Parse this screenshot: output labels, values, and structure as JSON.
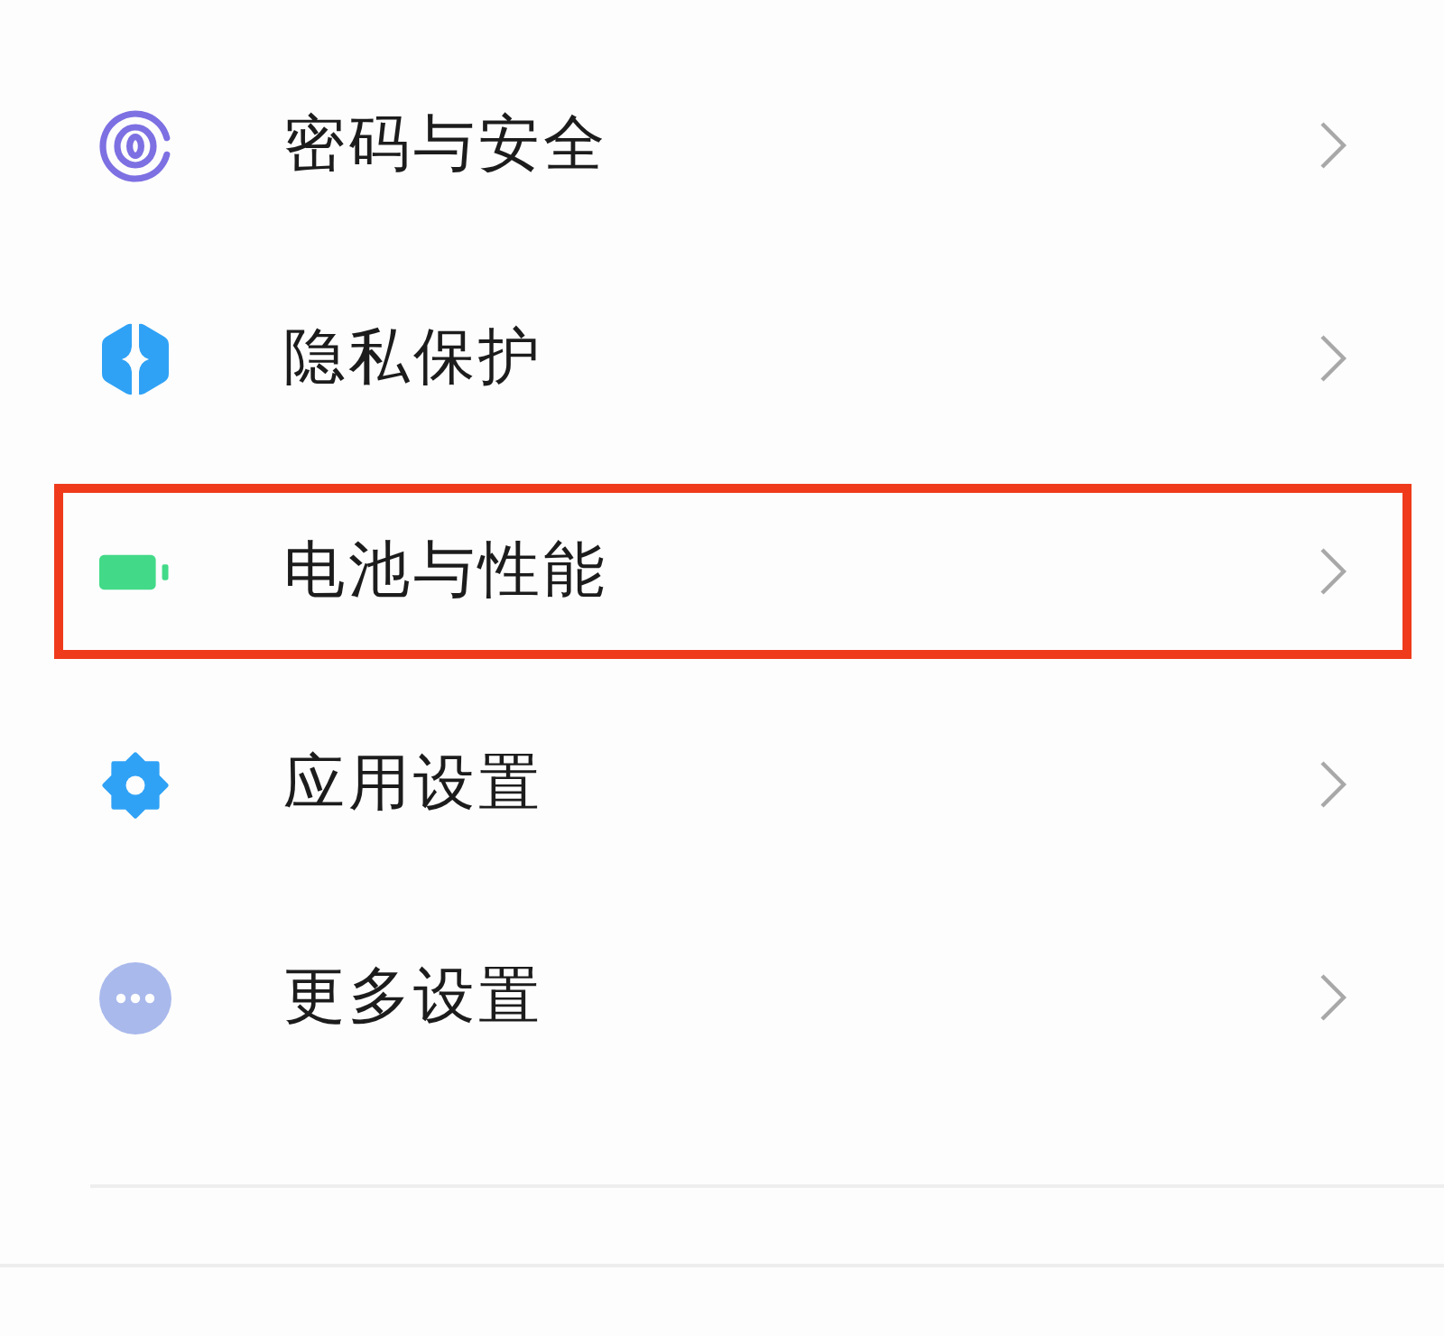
{
  "items": [
    {
      "kind": "fingerprint",
      "label": "密码与安全",
      "highlighted": false
    },
    {
      "kind": "shield",
      "label": "隐私保护",
      "highlighted": false
    },
    {
      "kind": "battery",
      "label": "电池与性能",
      "highlighted": true
    },
    {
      "kind": "gear",
      "label": "应用设置",
      "highlighted": false
    },
    {
      "kind": "more",
      "label": "更多设置",
      "highlighted": false
    }
  ]
}
